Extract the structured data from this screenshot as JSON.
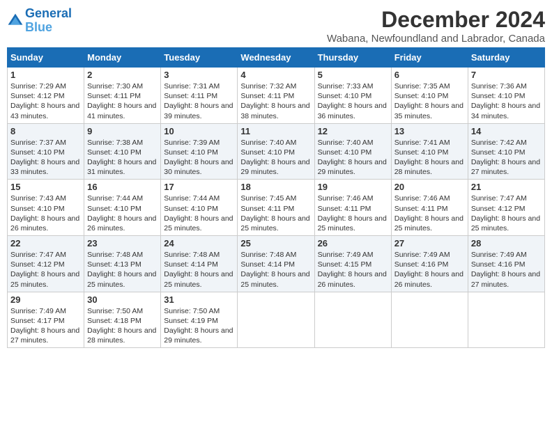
{
  "logo": {
    "line1": "General",
    "line2": "Blue"
  },
  "title": "December 2024",
  "location": "Wabana, Newfoundland and Labrador, Canada",
  "days_of_week": [
    "Sunday",
    "Monday",
    "Tuesday",
    "Wednesday",
    "Thursday",
    "Friday",
    "Saturday"
  ],
  "weeks": [
    [
      {
        "day": "1",
        "sunrise": "7:29 AM",
        "sunset": "4:12 PM",
        "daylight": "8 hours and 43 minutes."
      },
      {
        "day": "2",
        "sunrise": "7:30 AM",
        "sunset": "4:11 PM",
        "daylight": "8 hours and 41 minutes."
      },
      {
        "day": "3",
        "sunrise": "7:31 AM",
        "sunset": "4:11 PM",
        "daylight": "8 hours and 39 minutes."
      },
      {
        "day": "4",
        "sunrise": "7:32 AM",
        "sunset": "4:11 PM",
        "daylight": "8 hours and 38 minutes."
      },
      {
        "day": "5",
        "sunrise": "7:33 AM",
        "sunset": "4:10 PM",
        "daylight": "8 hours and 36 minutes."
      },
      {
        "day": "6",
        "sunrise": "7:35 AM",
        "sunset": "4:10 PM",
        "daylight": "8 hours and 35 minutes."
      },
      {
        "day": "7",
        "sunrise": "7:36 AM",
        "sunset": "4:10 PM",
        "daylight": "8 hours and 34 minutes."
      }
    ],
    [
      {
        "day": "8",
        "sunrise": "7:37 AM",
        "sunset": "4:10 PM",
        "daylight": "8 hours and 33 minutes."
      },
      {
        "day": "9",
        "sunrise": "7:38 AM",
        "sunset": "4:10 PM",
        "daylight": "8 hours and 31 minutes."
      },
      {
        "day": "10",
        "sunrise": "7:39 AM",
        "sunset": "4:10 PM",
        "daylight": "8 hours and 30 minutes."
      },
      {
        "day": "11",
        "sunrise": "7:40 AM",
        "sunset": "4:10 PM",
        "daylight": "8 hours and 29 minutes."
      },
      {
        "day": "12",
        "sunrise": "7:40 AM",
        "sunset": "4:10 PM",
        "daylight": "8 hours and 29 minutes."
      },
      {
        "day": "13",
        "sunrise": "7:41 AM",
        "sunset": "4:10 PM",
        "daylight": "8 hours and 28 minutes."
      },
      {
        "day": "14",
        "sunrise": "7:42 AM",
        "sunset": "4:10 PM",
        "daylight": "8 hours and 27 minutes."
      }
    ],
    [
      {
        "day": "15",
        "sunrise": "7:43 AM",
        "sunset": "4:10 PM",
        "daylight": "8 hours and 26 minutes."
      },
      {
        "day": "16",
        "sunrise": "7:44 AM",
        "sunset": "4:10 PM",
        "daylight": "8 hours and 26 minutes."
      },
      {
        "day": "17",
        "sunrise": "7:44 AM",
        "sunset": "4:10 PM",
        "daylight": "8 hours and 25 minutes."
      },
      {
        "day": "18",
        "sunrise": "7:45 AM",
        "sunset": "4:11 PM",
        "daylight": "8 hours and 25 minutes."
      },
      {
        "day": "19",
        "sunrise": "7:46 AM",
        "sunset": "4:11 PM",
        "daylight": "8 hours and 25 minutes."
      },
      {
        "day": "20",
        "sunrise": "7:46 AM",
        "sunset": "4:11 PM",
        "daylight": "8 hours and 25 minutes."
      },
      {
        "day": "21",
        "sunrise": "7:47 AM",
        "sunset": "4:12 PM",
        "daylight": "8 hours and 25 minutes."
      }
    ],
    [
      {
        "day": "22",
        "sunrise": "7:47 AM",
        "sunset": "4:12 PM",
        "daylight": "8 hours and 25 minutes."
      },
      {
        "day": "23",
        "sunrise": "7:48 AM",
        "sunset": "4:13 PM",
        "daylight": "8 hours and 25 minutes."
      },
      {
        "day": "24",
        "sunrise": "7:48 AM",
        "sunset": "4:14 PM",
        "daylight": "8 hours and 25 minutes."
      },
      {
        "day": "25",
        "sunrise": "7:48 AM",
        "sunset": "4:14 PM",
        "daylight": "8 hours and 25 minutes."
      },
      {
        "day": "26",
        "sunrise": "7:49 AM",
        "sunset": "4:15 PM",
        "daylight": "8 hours and 26 minutes."
      },
      {
        "day": "27",
        "sunrise": "7:49 AM",
        "sunset": "4:16 PM",
        "daylight": "8 hours and 26 minutes."
      },
      {
        "day": "28",
        "sunrise": "7:49 AM",
        "sunset": "4:16 PM",
        "daylight": "8 hours and 27 minutes."
      }
    ],
    [
      {
        "day": "29",
        "sunrise": "7:49 AM",
        "sunset": "4:17 PM",
        "daylight": "8 hours and 27 minutes."
      },
      {
        "day": "30",
        "sunrise": "7:50 AM",
        "sunset": "4:18 PM",
        "daylight": "8 hours and 28 minutes."
      },
      {
        "day": "31",
        "sunrise": "7:50 AM",
        "sunset": "4:19 PM",
        "daylight": "8 hours and 29 minutes."
      },
      null,
      null,
      null,
      null
    ]
  ]
}
